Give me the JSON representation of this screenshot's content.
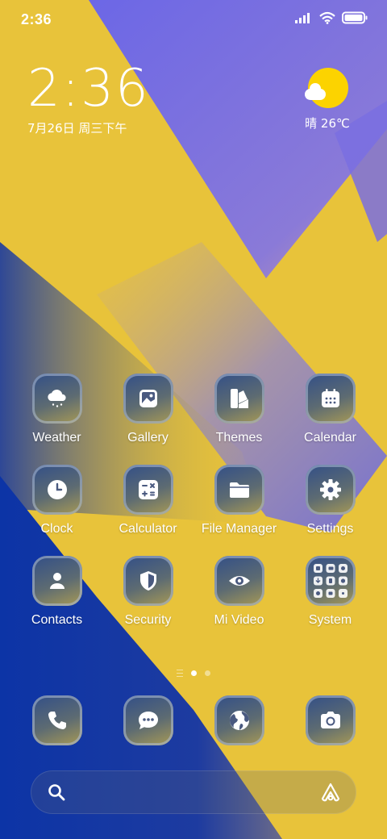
{
  "status_bar": {
    "time": "2:36"
  },
  "clock_widget": {
    "time": "2:36",
    "date": "7月26日 周三下午"
  },
  "weather_widget": {
    "text": "晴 26℃",
    "icon": "sun-cloud-icon"
  },
  "apps": [
    {
      "label": "Weather",
      "icon": "weather-cloud-icon"
    },
    {
      "label": "Gallery",
      "icon": "gallery-image-icon"
    },
    {
      "label": "Themes",
      "icon": "themes-palette-icon"
    },
    {
      "label": "Calendar",
      "icon": "calendar-icon"
    },
    {
      "label": "Clock",
      "icon": "clock-icon"
    },
    {
      "label": "Calculator",
      "icon": "calculator-icon"
    },
    {
      "label": "File Manager",
      "icon": "folder-icon"
    },
    {
      "label": "Settings",
      "icon": "gear-icon"
    },
    {
      "label": "Contacts",
      "icon": "person-icon"
    },
    {
      "label": "Security",
      "icon": "shield-icon"
    },
    {
      "label": "Mi Video",
      "icon": "eye-icon"
    },
    {
      "label": "System",
      "icon": "folder-grid-icon"
    }
  ],
  "page_indicator": {
    "pages": 2,
    "current": 1
  },
  "dock": [
    {
      "icon": "phone-icon"
    },
    {
      "icon": "message-icon"
    },
    {
      "icon": "browser-globe-icon"
    },
    {
      "icon": "camera-icon"
    }
  ],
  "search": {
    "icon": "search-icon",
    "assistant_icon": "assistant-icon"
  },
  "colors": {
    "wallpaper_yellow": "#e8c33a",
    "wallpaper_blue": "#0d35a8",
    "wallpaper_violet": "#7a6fe0",
    "sun": "#fcd300"
  }
}
